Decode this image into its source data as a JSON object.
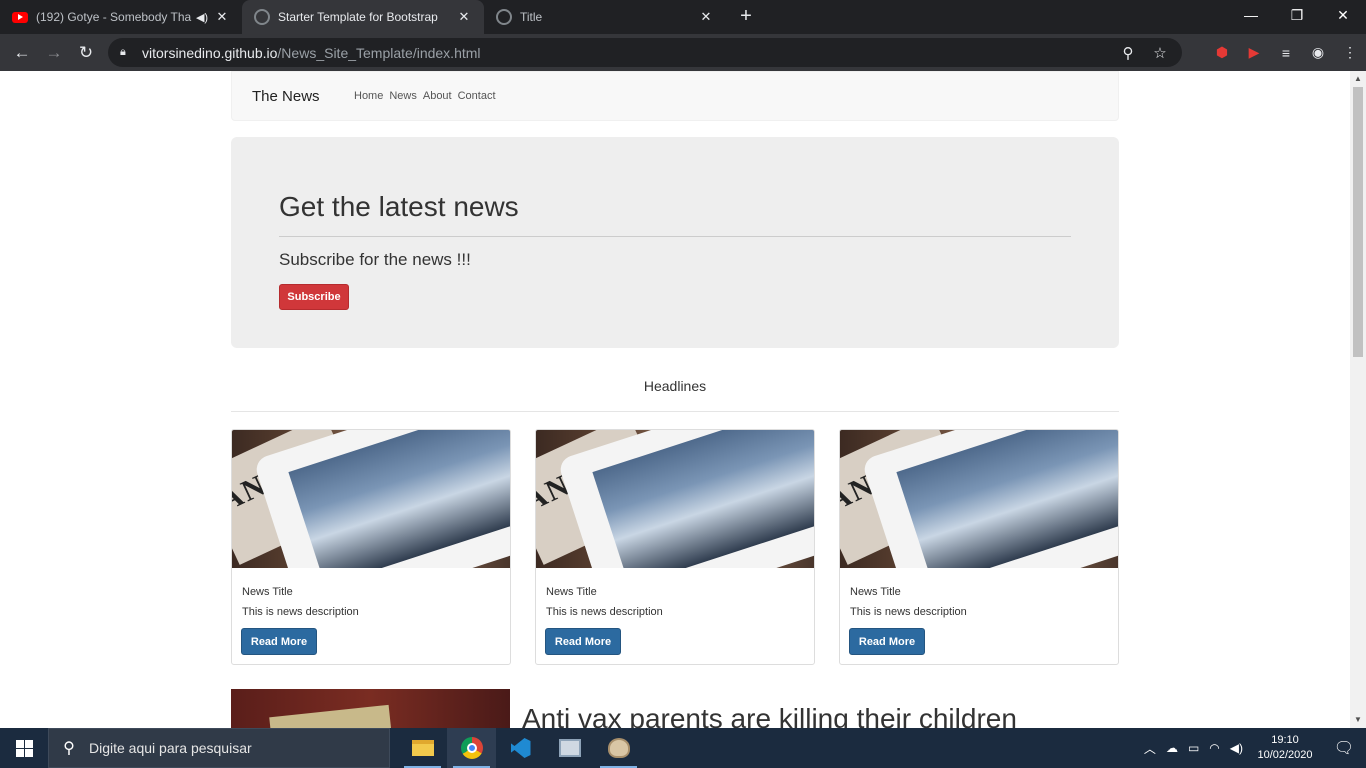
{
  "browser": {
    "tabs": [
      {
        "title": "(192) Gotye - Somebody Tha",
        "favicon": "youtube-icon",
        "audio": "speaker-icon"
      },
      {
        "title": "Starter Template for Bootstrap",
        "favicon": "globe-icon",
        "active": true
      },
      {
        "title": "Title",
        "favicon": "globe-icon"
      }
    ],
    "url_host": "vitorsinedino.github.io",
    "url_path": "/News_Site_Template/index.html"
  },
  "site": {
    "brand": "The News",
    "nav": [
      "Home",
      "News",
      "About",
      "Contact"
    ],
    "jumbotron": {
      "heading": "Get the latest news",
      "subtitle": "Subscribe for the news !!!",
      "button": "Subscribe"
    },
    "headlines_label": "Headlines",
    "cards": [
      {
        "title": "News Title",
        "description": "This is news description",
        "button": "Read More"
      },
      {
        "title": "News Title",
        "description": "This is news description",
        "button": "Read More"
      },
      {
        "title": "News Title",
        "description": "This is news description",
        "button": "Read More"
      }
    ],
    "article_title": "Anti vax parents are killing their children",
    "image_text": "ANCIAL"
  },
  "taskbar": {
    "search_placeholder": "Digite aqui para pesquisar",
    "time": "19:10",
    "date": "10/02/2020"
  },
  "colors": {
    "subscribe": "#d0373a",
    "read_more": "#2c6aa0",
    "taskbar": "#1b2b3f"
  }
}
